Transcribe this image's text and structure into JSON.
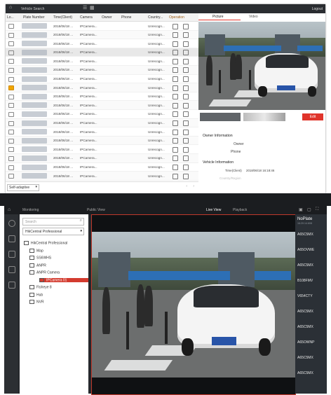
{
  "top": {
    "title": "Vehicle Search",
    "logout": "Logout",
    "columns": [
      "Lo...",
      "Plate Number",
      "Time(Client)",
      "Camera",
      "Owner",
      "Phone",
      "Country...",
      "Operation"
    ],
    "rows": [
      {
        "time": "2018/06/18 ...",
        "camera": "IPCamera...",
        "country": "Unrecogn..."
      },
      {
        "time": "2018/06/18 ...",
        "camera": "IPCamera...",
        "country": "Unrecogn..."
      },
      {
        "time": "2018/06/18 ...",
        "camera": "IPCamera...",
        "country": "Unrecogn..."
      },
      {
        "time": "2018/06/18 ...",
        "camera": "IPCamera...",
        "country": "Unrecogn..."
      },
      {
        "time": "2018/06/18 ...",
        "camera": "IPCamera...",
        "country": "Unrecogn..."
      },
      {
        "time": "2018/06/18 ...",
        "camera": "IPCamera...",
        "country": "Unrecogn..."
      },
      {
        "time": "2018/06/18 ...",
        "camera": "IPCamera...",
        "country": "Unrecogn..."
      },
      {
        "time": "2018/06/18 ...",
        "camera": "IPCamera...",
        "country": "Unrecogn..."
      },
      {
        "time": "2018/06/18 ...",
        "camera": "IPCamera...",
        "country": "Unrecogn..."
      },
      {
        "time": "2018/06/18 ...",
        "camera": "IPCamera...",
        "country": "Unrecogn..."
      },
      {
        "time": "2018/06/18 ...",
        "camera": "IPCamera...",
        "country": "Unrecogn..."
      },
      {
        "time": "2018/06/18 ...",
        "camera": "IPCamera...",
        "country": "Unrecogn..."
      },
      {
        "time": "2018/06/18 ...",
        "camera": "IPCamera...",
        "country": "Unrecogn..."
      },
      {
        "time": "2018/06/18 ...",
        "camera": "IPCamera...",
        "country": "Unrecogn..."
      },
      {
        "time": "2018/06/18 ...",
        "camera": "IPCamera...",
        "country": "Unrecogn..."
      },
      {
        "time": "2018/06/18 ...",
        "camera": "IPCamera...",
        "country": "Unrecogn..."
      },
      {
        "time": "2018/06/18 ...",
        "camera": "IPCamera...",
        "country": "Unrecogn..."
      },
      {
        "time": "2018/06/18 ...",
        "camera": "IPCamera...",
        "country": "Unrecogn..."
      },
      {
        "time": "2018/06/18 ...",
        "camera": "IPCamera...",
        "country": "Unrecogn..."
      },
      {
        "time": "2018/06/18 ...",
        "camera": "IPCamera...",
        "country": "Unrecogn..."
      }
    ],
    "footer_select": "Self-adaptive",
    "detail": {
      "tab_picture": "Picture",
      "tab_video": "Video",
      "edit": "Edit",
      "owner_info": "Owner Information",
      "owner_label": "Owner",
      "phone_label": "Phone",
      "vehicle_info": "Vehicle Information",
      "time_label": "Time(Client)",
      "time_value": "2018/06/18 16:18:46",
      "country_label": "Country/Region"
    }
  },
  "bottom": {
    "module": "Monitoring",
    "public_view": "Public View",
    "tab_live": "Live View",
    "tab_playback": "Playback",
    "search_placeholder": "Search",
    "site": "HikCentral Professional",
    "tree": [
      {
        "label": "HikCentral Professional",
        "level": 0
      },
      {
        "label": "Map",
        "level": 1
      },
      {
        "label": "SS6WHS",
        "level": 1
      },
      {
        "label": "ANPR",
        "level": 1
      },
      {
        "label": "ANPR Camera",
        "level": 1
      },
      {
        "label": "IPCamera 01",
        "level": 2,
        "selected": true
      },
      {
        "label": "Fisheye 8",
        "level": 1
      },
      {
        "label": "Hub",
        "level": 1
      },
      {
        "label": "NVR",
        "level": 1
      }
    ],
    "plates": [
      {
        "plate": "NoPlate",
        "time": "16:20:14.608"
      },
      {
        "plate": "A65C5MX",
        "time": ""
      },
      {
        "plate": "A65OVWE",
        "time": ""
      },
      {
        "plate": "A65C5MX",
        "time": ""
      },
      {
        "plate": "B108FMV",
        "time": ""
      },
      {
        "plate": "V654CTY",
        "time": ""
      },
      {
        "plate": "A65C5MX",
        "time": ""
      },
      {
        "plate": "A65C5MX",
        "time": ""
      },
      {
        "plate": "A65OWNP",
        "time": ""
      },
      {
        "plate": "A65C5MX",
        "time": ""
      },
      {
        "plate": "A65C5MX",
        "time": ""
      }
    ]
  },
  "colors": {
    "accent_red": "#e0342b",
    "dark": "#25282c",
    "selected_red": "#d33b2f"
  }
}
